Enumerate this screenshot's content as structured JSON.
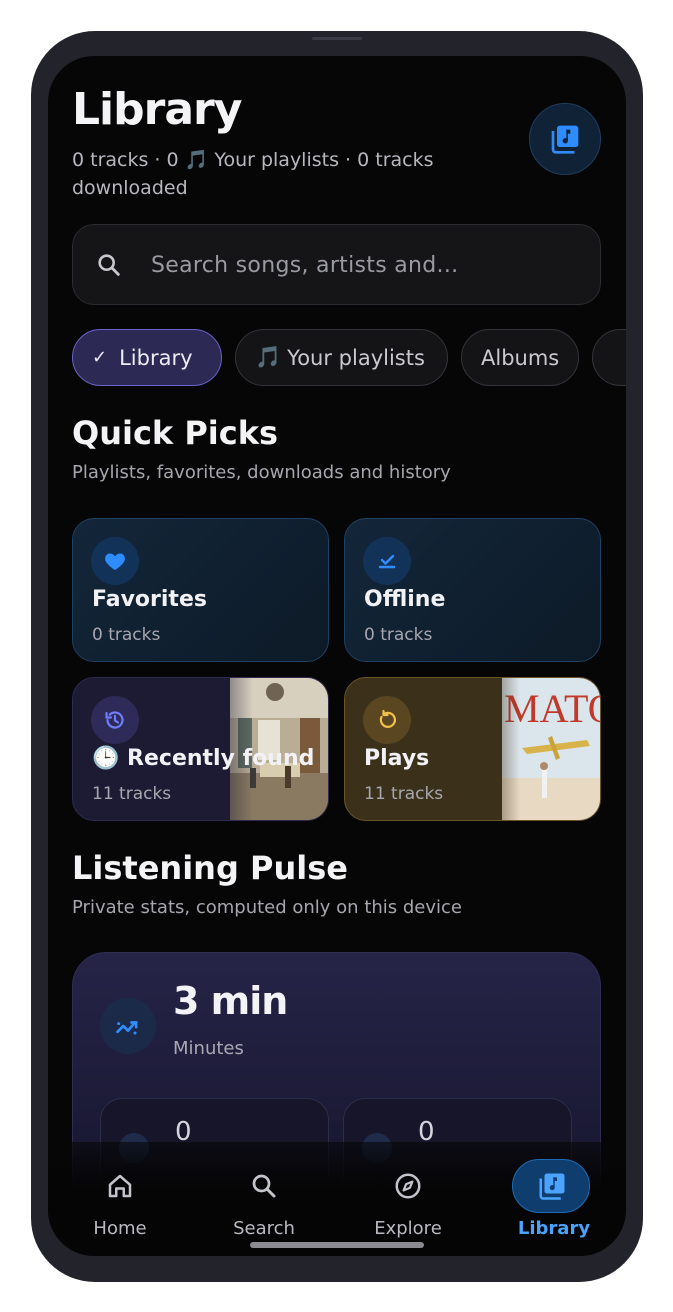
{
  "header": {
    "title": "Library",
    "subtitle_part1": "0 tracks · 0",
    "subtitle_note": "🎵",
    "subtitle_part2": "Your playlists · 0 tracks downloaded",
    "action_icon": "library-music-icon"
  },
  "search": {
    "placeholder": "Search songs, artists and..."
  },
  "chips": [
    {
      "label": "Library",
      "active": true,
      "icon": "check-icon"
    },
    {
      "label": "Your playlists",
      "active": false,
      "icon": "🎵"
    },
    {
      "label": "Albums",
      "active": false
    }
  ],
  "quick_picks": {
    "title": "Quick Picks",
    "subtitle": "Playlists, favorites, downloads and history",
    "cards": [
      {
        "title": "Favorites",
        "count": "0 tracks",
        "icon": "heart-icon"
      },
      {
        "title": "Offline",
        "count": "0 tracks",
        "icon": "download-done-icon"
      },
      {
        "title": "🕒 Recently found",
        "count": "11 tracks",
        "icon": "history-icon"
      },
      {
        "title": "Plays",
        "count": "11 tracks",
        "icon": "replay-icon",
        "art_text": "MATOR"
      }
    ]
  },
  "pulse": {
    "title": "Listening Pulse",
    "subtitle": "Private stats, computed only on this device",
    "value": "3 min",
    "label": "Minutes",
    "mini_values": [
      "0",
      "0"
    ]
  },
  "nav": {
    "items": [
      {
        "label": "Home",
        "icon": "home-icon",
        "active": false
      },
      {
        "label": "Search",
        "icon": "search-icon",
        "active": false
      },
      {
        "label": "Explore",
        "icon": "compass-icon",
        "active": false
      },
      {
        "label": "Library",
        "icon": "library-music-icon",
        "active": true
      }
    ]
  },
  "colors": {
    "accent": "#4aa3ff",
    "chip_active": "#2c2a55",
    "gold_card": "#3b301a",
    "background": "#060607"
  }
}
